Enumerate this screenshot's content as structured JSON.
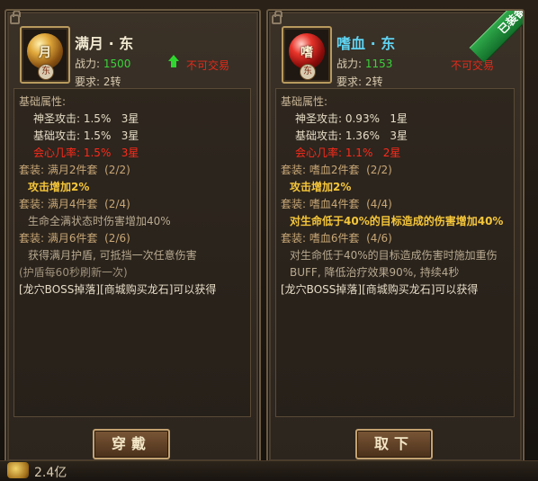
{
  "currency": {
    "amount": "2.4亿",
    "icon": "gold-coin-icon"
  },
  "left_item": {
    "name": "满月 · 东",
    "orb_glyph": "月",
    "grade": "东",
    "power_label": "战力:",
    "power_value": "1500",
    "requirement": "要求: 2转",
    "trade_status": "不可交易",
    "section_label": "基础属性:",
    "attrs": [
      "神圣攻击: 1.5%   3星",
      "基础攻击: 1.5%   3星"
    ],
    "crit": "会心几率: 1.5%   3星",
    "set2": "套装: 满月2件套  (2/2)",
    "set2_bonus": "攻击增加2%",
    "set4": "套装: 满月4件套  (2/4)",
    "set4_bonus": "生命全满状态时伤害增加40%",
    "set6": "套装: 满月6件套  (2/6)",
    "set6_bonus_a": "获得满月护盾, 可抵挡一次任意伤害",
    "set6_bonus_b": "(护盾每60秒刷新一次)",
    "source": "[龙穴BOSS掉落][商城购买龙石]可以获得",
    "button": "穿戴"
  },
  "right_item": {
    "name": "嗜血 · 东",
    "orb_glyph": "嗜",
    "grade": "东",
    "power_label": "战力:",
    "power_value": "1153",
    "requirement": "要求: 2转",
    "trade_status": "不可交易",
    "equipped_badge": "已装备",
    "section_label": "基础属性:",
    "attrs": [
      "神圣攻击: 0.93%   1星",
      "基础攻击: 1.36%   3星"
    ],
    "crit": "会心几率: 1.1%   2星",
    "set2": "套装: 嗜血2件套  (2/2)",
    "set2_bonus": "攻击增加2%",
    "set4": "套装: 嗜血4件套  (4/4)",
    "set4_bonus": "对生命低于40%的目标造成的伤害增加40%",
    "set6": "套装: 嗜血6件套  (4/6)",
    "set6_bonus": "对生命低于40%的目标造成伤害时施加重伤BUFF, 降低治疗效果90%, 持续4秒",
    "source": "[龙穴BOSS掉落][商城购买龙石]可以获得",
    "button": "取下"
  }
}
